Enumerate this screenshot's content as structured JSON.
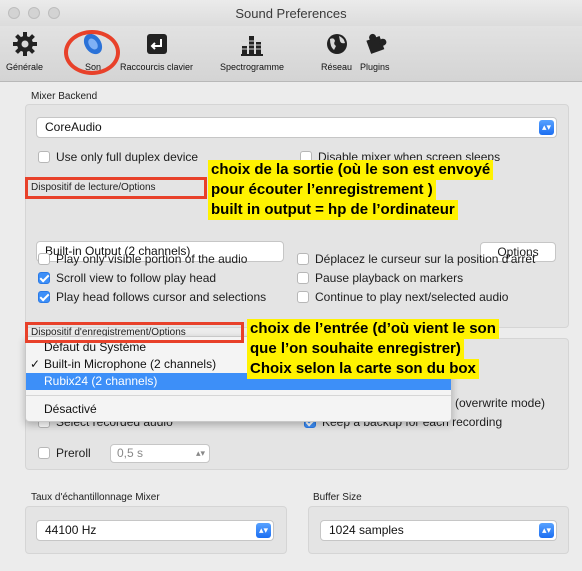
{
  "window": {
    "title": "Sound Preferences"
  },
  "toolbar": {
    "items": [
      {
        "label": "Générale",
        "icon": "gear-icon"
      },
      {
        "label": "Son",
        "icon": "speaker-icon"
      },
      {
        "label": "Raccourcis clavier",
        "icon": "keyboard-icon"
      },
      {
        "label": "Spectrogramme",
        "icon": "spectrogram-icon"
      },
      {
        "label": "Réseau",
        "icon": "globe-icon"
      },
      {
        "label": "Plugins",
        "icon": "puzzle-icon"
      }
    ]
  },
  "mixer_backend": {
    "label": "Mixer Backend",
    "value": "CoreAudio"
  },
  "full_duplex": {
    "label": "Use only full duplex device",
    "checked": false
  },
  "disable_mixer": {
    "label": "Disable mixer when screen sleeps",
    "checked": false
  },
  "playback": {
    "label": "Dispositif de lecture/Options",
    "device": "Built-in Output (2 channels)",
    "options_button": "Options"
  },
  "playback_options": {
    "left": [
      {
        "label": "Play only visible portion of the audio",
        "checked": false
      },
      {
        "label": "Scroll view to follow play head",
        "checked": true
      },
      {
        "label": "Play head follows cursor and selections",
        "checked": true
      }
    ],
    "right": [
      {
        "label": "Déplacez le curseur sur la position d'arrêt",
        "checked": false
      },
      {
        "label": "Pause playback on markers",
        "checked": false
      },
      {
        "label": "Continue to play next/selected audio",
        "checked": false
      }
    ]
  },
  "recording": {
    "label": "Dispositif d'enregistrement/Options",
    "menu": [
      {
        "label": "Défaut du Système",
        "checked": false,
        "highlighted": false
      },
      {
        "label": "Built-in Microphone (2 channels)",
        "checked": true,
        "highlighted": false
      },
      {
        "label": "Rubix24 (2 channels)",
        "checked": false,
        "highlighted": true
      },
      {
        "label": "Désactivé",
        "checked": false,
        "highlighted": false
      }
    ],
    "checkmark": "✓",
    "select_recorded_audio": {
      "label": "Select recorded audio",
      "checked": false
    },
    "overwrite_mode_text": "(overwrite mode)",
    "keep_backup": {
      "label": "Keep a backup for each recording",
      "checked": true
    },
    "preroll": {
      "label": "Preroll",
      "value": "0,5 s",
      "checked": false
    }
  },
  "sample_rate": {
    "label": "Taux d'échantillonnage Mixer",
    "value": "44100 Hz"
  },
  "buffer_size": {
    "label": "Buffer Size",
    "value": "1024 samples"
  },
  "annotations": {
    "output": [
      "choix de la sortie (où le son est envoyé",
      "pour écouter l’enregistrement )",
      "built in output = hp de l’ordinateur"
    ],
    "input": [
      "choix de l’entrée (d’où vient le son",
      "que l’on souhaite enregistrer)",
      "Choix selon la carte son du box"
    ]
  },
  "colors": {
    "accent": "#3d8ff8",
    "highlight_annotation": "#fff200",
    "annotation_border": "#e8412a"
  }
}
